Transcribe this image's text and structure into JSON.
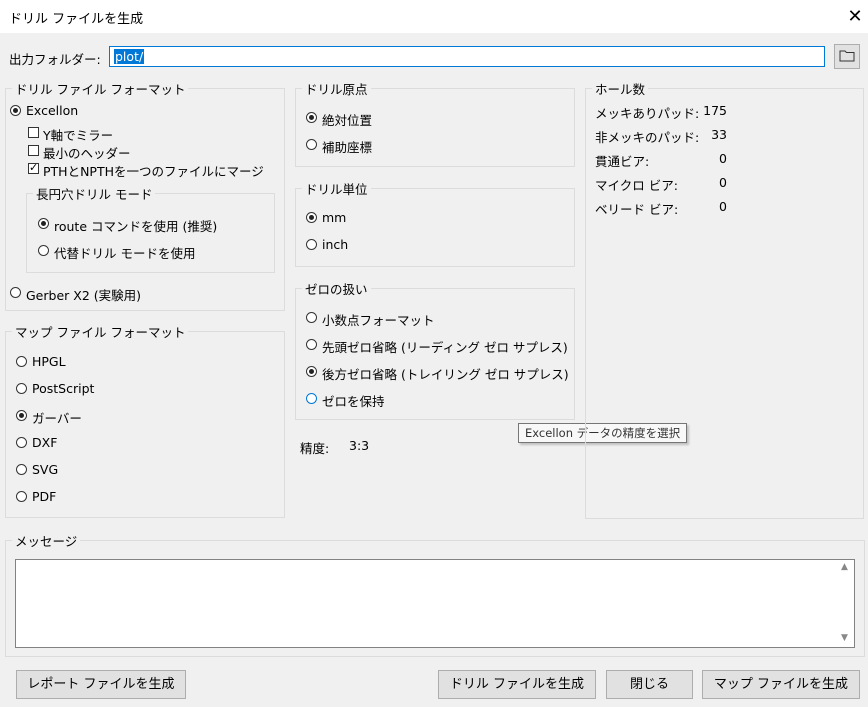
{
  "window": {
    "title": "ドリル ファイルを生成",
    "close": "✕"
  },
  "output": {
    "label": "出力フォルダー:",
    "value": "plot/",
    "folder_icon": "folder-icon"
  },
  "drill_format": {
    "legend": "ドリル ファイル フォーマット",
    "excellon": "Excellon",
    "mirror_y": "Y軸でミラー",
    "minimal_header": "最小のヘッダー",
    "merge_pth": "PTHとNPTHを一つのファイルにマージ",
    "oval": {
      "legend": "長円穴ドリル モード",
      "route": "route コマンドを使用 (推奨)",
      "alt": "代替ドリル モードを使用"
    },
    "gerber": "Gerber X2 (実験用)"
  },
  "map_format": {
    "legend": "マップ ファイル フォーマット",
    "options": [
      "HPGL",
      "PostScript",
      "ガーバー",
      "DXF",
      "SVG",
      "PDF"
    ],
    "selected": "ガーバー"
  },
  "origin": {
    "legend": "ドリル原点",
    "absolute": "絶対位置",
    "aux": "補助座標"
  },
  "units": {
    "legend": "ドリル単位",
    "mm": "mm",
    "inch": "inch"
  },
  "zeros": {
    "legend": "ゼロの扱い",
    "decimal": "小数点フォーマット",
    "leading": "先頭ゼロ省略 (リーディング ゼロ サプレス)",
    "trailing": "後方ゼロ省略 (トレイリング ゼロ サプレス)",
    "keep": "ゼロを保持"
  },
  "precision": {
    "label": "精度:",
    "value": "3:3"
  },
  "tooltip": "Excellon データの精度を選択",
  "holes": {
    "legend": "ホール数",
    "rows": [
      {
        "label": "メッキありパッド:",
        "value": "175"
      },
      {
        "label": "非メッキのパッド:",
        "value": "33"
      },
      {
        "label": "貫通ビア:",
        "value": "0"
      },
      {
        "label": "マイクロ ビア:",
        "value": "0"
      },
      {
        "label": "ベリード ビア:",
        "value": "0"
      }
    ]
  },
  "messages": {
    "legend": "メッセージ"
  },
  "buttons": {
    "report": "レポート ファイルを生成",
    "drill": "ドリル ファイルを生成",
    "close": "閉じる",
    "map": "マップ ファイルを生成"
  }
}
